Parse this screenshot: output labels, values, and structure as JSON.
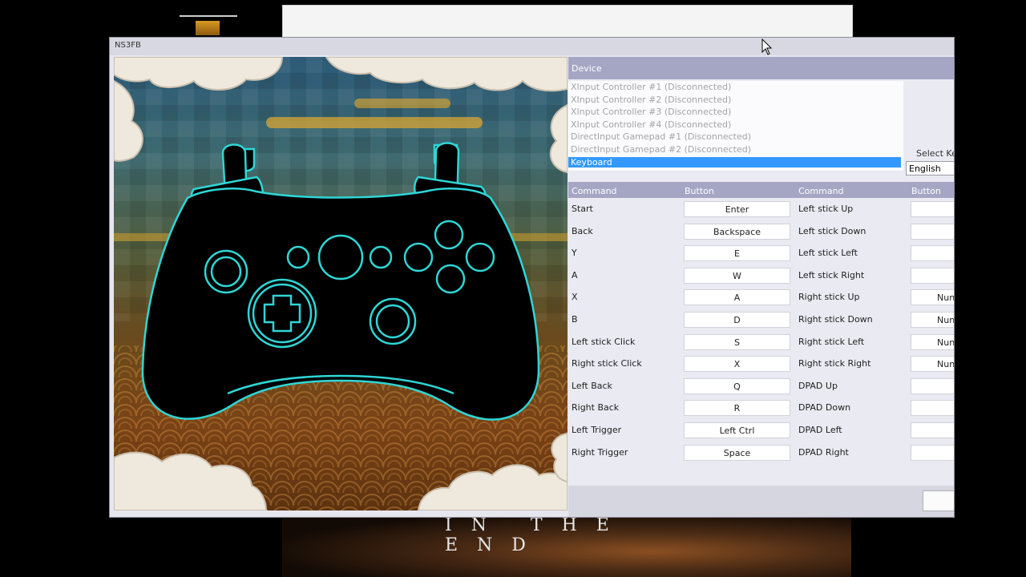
{
  "background": {
    "caption": "IN THE END"
  },
  "window": {
    "title": "NS3FB"
  },
  "device": {
    "header": "Device",
    "items": [
      "XInput Controller #1 (Disconnected)",
      "XInput Controller #2 (Disconnected)",
      "XInput Controller #3 (Disconnected)",
      "XInput Controller #4 (Disconnected)",
      "DirectInput Gamepad #1 (Disconnected)",
      "DirectInput Gamepad #2 (Disconnected)",
      "Keyboard"
    ],
    "selected_index": 6
  },
  "keyboard_layout": {
    "label": "Select Ke",
    "value": "English"
  },
  "mapping": {
    "headers": [
      "Command",
      "Button",
      "Command",
      "Button"
    ],
    "left": [
      {
        "command": "Start",
        "button": "Enter"
      },
      {
        "command": "Back",
        "button": "Backspace"
      },
      {
        "command": "Y",
        "button": "E"
      },
      {
        "command": "A",
        "button": "W"
      },
      {
        "command": "X",
        "button": "A"
      },
      {
        "command": "B",
        "button": "D"
      },
      {
        "command": "Left stick Click",
        "button": "S"
      },
      {
        "command": "Right stick Click",
        "button": "X"
      },
      {
        "command": "Left Back",
        "button": "Q"
      },
      {
        "command": "Right Back",
        "button": "R"
      },
      {
        "command": "Left Trigger",
        "button": "Left Ctrl"
      },
      {
        "command": "Right Trigger",
        "button": "Space"
      }
    ],
    "right": [
      {
        "command": "Left stick Up",
        "button": ""
      },
      {
        "command": "Left stick Down",
        "button": ""
      },
      {
        "command": "Left stick Left",
        "button": ""
      },
      {
        "command": "Left stick Right",
        "button": ""
      },
      {
        "command": "Right stick Up",
        "button": "Nun"
      },
      {
        "command": "Right stick Down",
        "button": "Nun"
      },
      {
        "command": "Right stick Left",
        "button": "Nun"
      },
      {
        "command": "Right stick Right",
        "button": "Nun"
      },
      {
        "command": "DPAD Up",
        "button": ""
      },
      {
        "command": "DPAD Down",
        "button": ""
      },
      {
        "command": "DPAD Left",
        "button": ""
      },
      {
        "command": "DPAD Right",
        "button": ""
      }
    ]
  },
  "colors": {
    "controller_outline": "#2fd6d6",
    "selection": "#3399ff",
    "header_band": "#a5a6c4"
  }
}
